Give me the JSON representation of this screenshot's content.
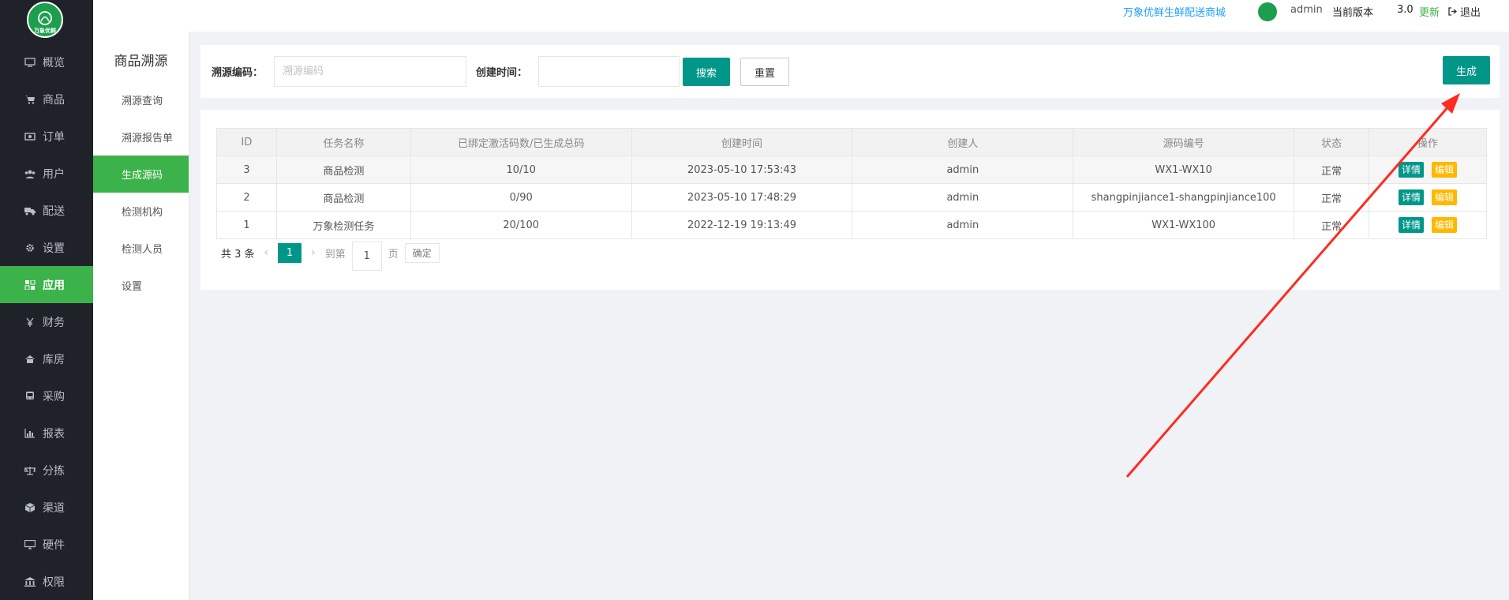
{
  "header": {
    "shop_name": "万象优鲜生鲜配送商城",
    "user": "admin",
    "version_label": "当前版本",
    "version": "3.0",
    "update": "更新",
    "logout": "退出"
  },
  "sidebar": {
    "items": [
      {
        "label": "概览",
        "icon": "monitor-icon"
      },
      {
        "label": "商品",
        "icon": "cart-icon"
      },
      {
        "label": "订单",
        "icon": "money-icon"
      },
      {
        "label": "用户",
        "icon": "users-icon"
      },
      {
        "label": "配送",
        "icon": "truck-icon"
      },
      {
        "label": "设置",
        "icon": "gear-icon"
      },
      {
        "label": "应用",
        "icon": "apps-icon"
      },
      {
        "label": "财务",
        "icon": "yen-icon"
      },
      {
        "label": "库房",
        "icon": "home-icon"
      },
      {
        "label": "采购",
        "icon": "bus-icon"
      },
      {
        "label": "报表",
        "icon": "bar-chart-icon"
      },
      {
        "label": "分拣",
        "icon": "scale-icon"
      },
      {
        "label": "渠道",
        "icon": "cube-icon"
      },
      {
        "label": "硬件",
        "icon": "desktop-icon"
      },
      {
        "label": "权限",
        "icon": "bank-icon"
      }
    ],
    "active": "应用"
  },
  "subnav": {
    "title": "商品溯源",
    "items": [
      "溯源查询",
      "溯源报告单",
      "生成源码",
      "检测机构",
      "检测人员",
      "设置"
    ],
    "active": "生成源码"
  },
  "search": {
    "code_label": "溯源编码：",
    "code_placeholder": "溯源编码",
    "time_label": "创建时间：",
    "search_btn": "搜索",
    "reset_btn": "重置",
    "generate_btn": "生成"
  },
  "table": {
    "columns": [
      "ID",
      "任务名称",
      "已绑定激活码数/已生成总码",
      "创建时间",
      "创建人",
      "源码编号",
      "状态",
      "操作"
    ],
    "rows": [
      {
        "id": "3",
        "name": "商品检测",
        "codes": "10/10",
        "time": "2023-05-10 17:53:43",
        "creator": "admin",
        "source": "WX1-WX10",
        "status": "正常"
      },
      {
        "id": "2",
        "name": "商品检测",
        "codes": "0/90",
        "time": "2023-05-10 17:48:29",
        "creator": "admin",
        "source": "shangpinjiance1-shangpinjiance100",
        "status": "正常"
      },
      {
        "id": "1",
        "name": "万象检测任务",
        "codes": "20/100",
        "time": "2022-12-19 19:13:49",
        "creator": "admin",
        "source": "WX1-WX100",
        "status": "正常"
      }
    ],
    "detail_label": "详情",
    "edit_label": "编辑"
  },
  "pager": {
    "count": "共 3 条",
    "prev": "‹",
    "current": "1",
    "next": "›",
    "goto": "到第",
    "page_input": "1",
    "unit": "页",
    "confirm": "确定"
  },
  "colors": {
    "sidebar_bg": "#20222a",
    "active_green": "#3cb34a",
    "primary_teal": "#009688",
    "warn_yellow": "#ffb800",
    "annotation_red": "#ff2b20"
  }
}
